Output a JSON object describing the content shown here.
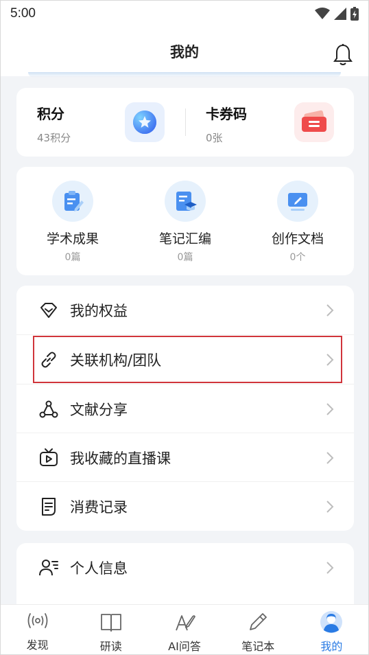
{
  "status_bar": {
    "time": "5:00"
  },
  "header": {
    "title": "我的"
  },
  "points": {
    "points_label": "积分",
    "points_value": "43积分",
    "coupon_label": "卡券码",
    "coupon_value": "0张"
  },
  "tiles": [
    {
      "label": "学术成果",
      "count": "0篇"
    },
    {
      "label": "笔记汇编",
      "count": "0篇"
    },
    {
      "label": "创作文档",
      "count": "0个"
    }
  ],
  "menu": [
    {
      "label": "我的权益",
      "icon": "diamond-icon"
    },
    {
      "label": "关联机构/团队",
      "icon": "link-icon"
    },
    {
      "label": "文献分享",
      "icon": "share-icon"
    },
    {
      "label": "我收藏的直播课",
      "icon": "tv-icon"
    },
    {
      "label": "消费记录",
      "icon": "receipt-icon"
    }
  ],
  "profile": {
    "label": "个人信息",
    "icon": "user-icon"
  },
  "tabbar": [
    {
      "label": "发现",
      "icon": "radar-icon"
    },
    {
      "label": "研读",
      "icon": "book-icon"
    },
    {
      "label": "AI问答",
      "icon": "ai-pen-icon"
    },
    {
      "label": "笔记本",
      "icon": "pencil-icon"
    },
    {
      "label": "我的",
      "icon": "avatar-icon"
    }
  ],
  "colors": {
    "accent": "#2a7be4",
    "highlight": "#d0343a"
  }
}
